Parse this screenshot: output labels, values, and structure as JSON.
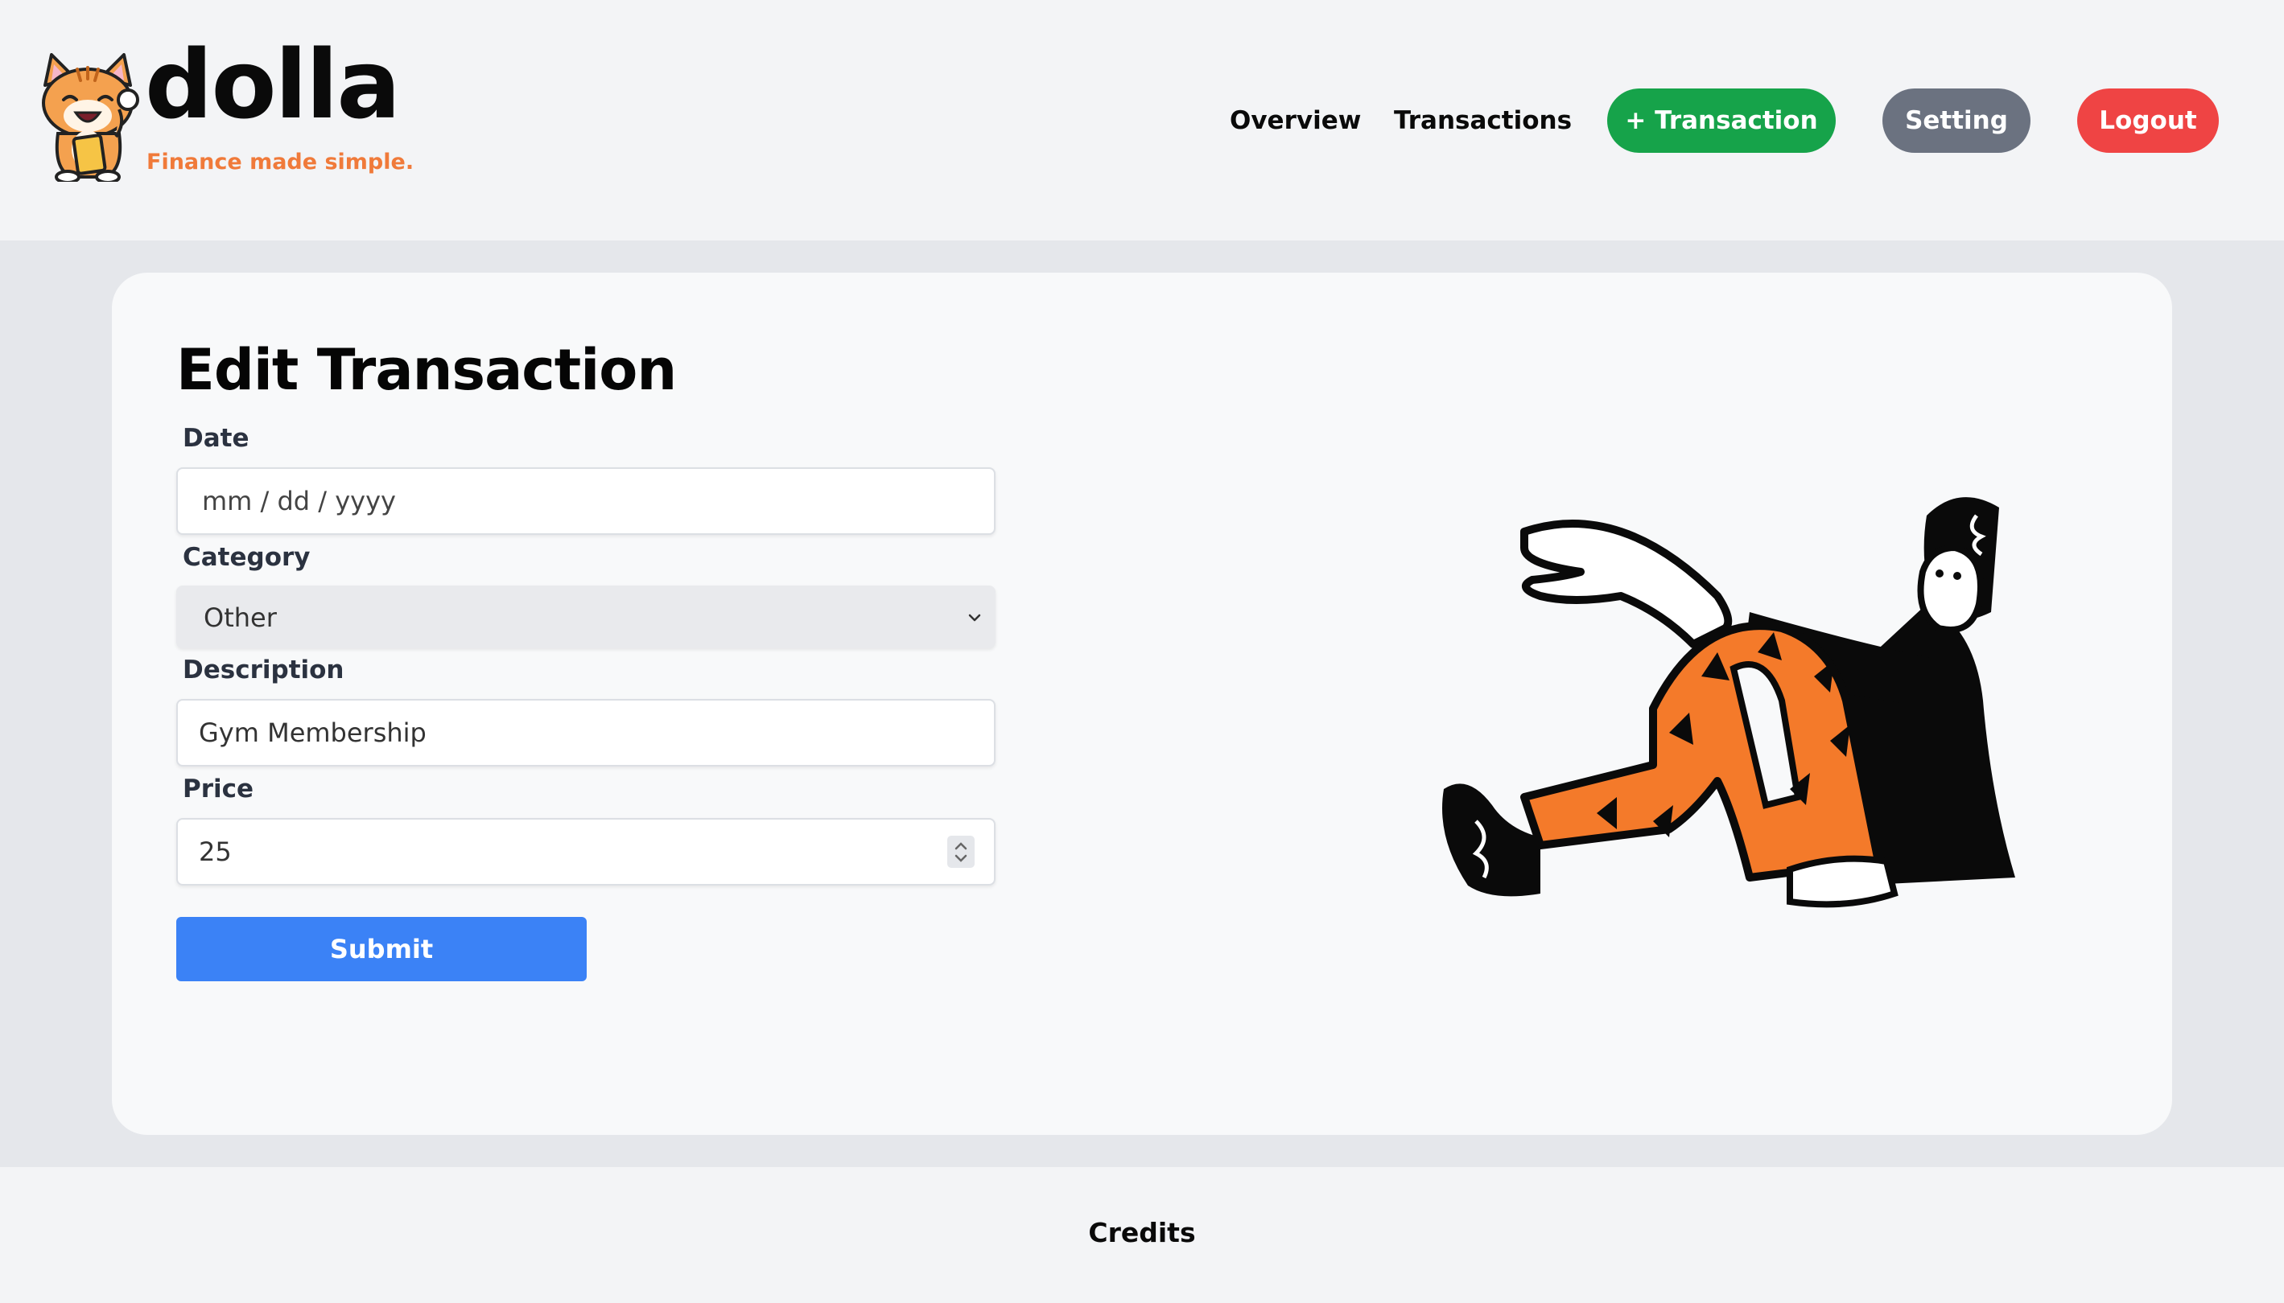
{
  "brand": {
    "name": "dolla",
    "tagline": "Finance made simple.",
    "accent": "#f07a3a"
  },
  "nav": {
    "overview": "Overview",
    "transactions": "Transactions",
    "add_transaction": "+ Transaction",
    "setting": "Setting",
    "logout": "Logout",
    "colors": {
      "add": "#16a34a",
      "setting": "#6b7280",
      "logout": "#ef4444"
    }
  },
  "form": {
    "title": "Edit Transaction",
    "date": {
      "label": "Date",
      "placeholder": "mm / dd / yyyy"
    },
    "category": {
      "label": "Category",
      "value": "Other"
    },
    "description": {
      "label": "Description",
      "value": "Gym Membership"
    },
    "price": {
      "label": "Price",
      "value": "25"
    },
    "submit": "Submit",
    "submit_color": "#3b82f6"
  },
  "footer": {
    "credits": "Credits"
  }
}
